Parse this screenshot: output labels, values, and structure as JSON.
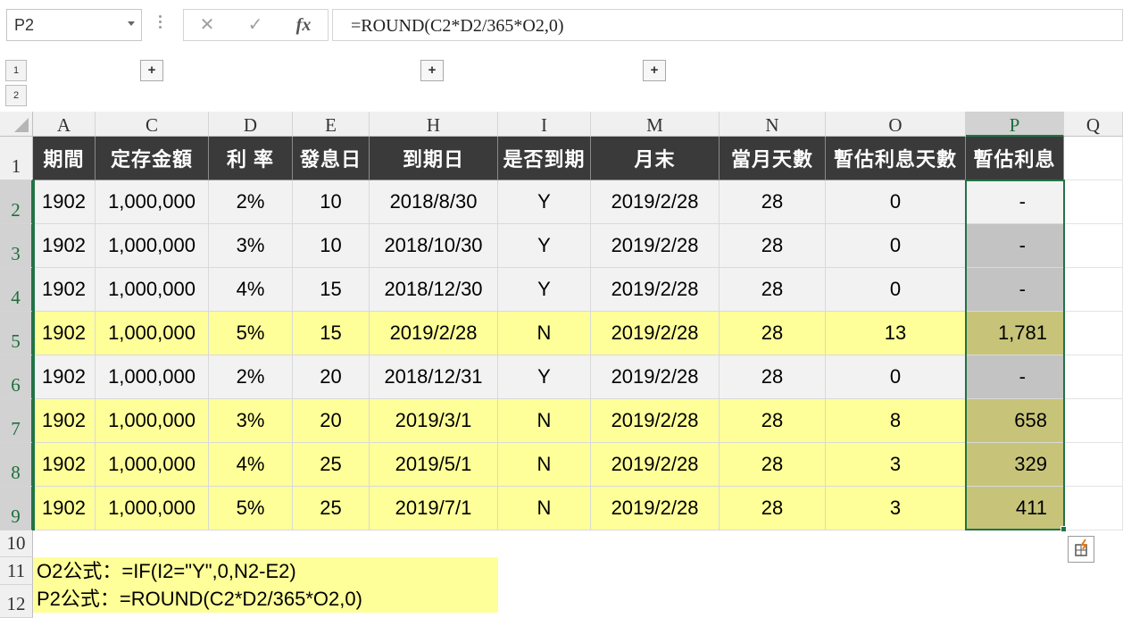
{
  "namebox": {
    "value": "P2"
  },
  "formula_bar": {
    "cancel": "✕",
    "enter": "✓",
    "fx": "fx",
    "value": "=ROUND(C2*D2/365*O2,0)"
  },
  "outline": {
    "levels": [
      "1",
      "2"
    ],
    "expand": "+"
  },
  "columns": [
    "A",
    "C",
    "D",
    "E",
    "H",
    "I",
    "M",
    "N",
    "O",
    "P",
    "Q"
  ],
  "rows": [
    "1",
    "2",
    "3",
    "4",
    "5",
    "6",
    "7",
    "8",
    "9",
    "10",
    "11",
    "12"
  ],
  "table": {
    "headers": [
      "期間",
      "定存金額",
      "利 率",
      "發息日",
      "到期日",
      "是否到期",
      "月末",
      "當月天數",
      "暫估利息天數",
      "暫估利息"
    ],
    "data": [
      [
        "1902",
        "1,000,000",
        "2%",
        "10",
        "2018/8/30",
        "Y",
        "2019/2/28",
        "28",
        "0",
        "-"
      ],
      [
        "1902",
        "1,000,000",
        "3%",
        "10",
        "2018/10/30",
        "Y",
        "2019/2/28",
        "28",
        "0",
        "-"
      ],
      [
        "1902",
        "1,000,000",
        "4%",
        "15",
        "2018/12/30",
        "Y",
        "2019/2/28",
        "28",
        "0",
        "-"
      ],
      [
        "1902",
        "1,000,000",
        "5%",
        "15",
        "2019/2/28",
        "N",
        "2019/2/28",
        "28",
        "13",
        "1,781"
      ],
      [
        "1902",
        "1,000,000",
        "2%",
        "20",
        "2018/12/31",
        "Y",
        "2019/2/28",
        "28",
        "0",
        "-"
      ],
      [
        "1902",
        "1,000,000",
        "3%",
        "20",
        "2019/3/1",
        "N",
        "2019/2/28",
        "28",
        "8",
        "658"
      ],
      [
        "1902",
        "1,000,000",
        "4%",
        "25",
        "2019/5/1",
        "N",
        "2019/2/28",
        "28",
        "3",
        "329"
      ],
      [
        "1902",
        "1,000,000",
        "5%",
        "25",
        "2019/7/1",
        "N",
        "2019/2/28",
        "28",
        "3",
        "411"
      ]
    ]
  },
  "notes": [
    "O2公式：=IF(I2=\"Y\",0,N2-E2)",
    "P2公式：=ROUND(C2*D2/365*O2,0)"
  ],
  "colors": {
    "header_bg": "#3a3a3a",
    "highlight_yellow": "#ffff99",
    "selection_green": "#217346"
  }
}
